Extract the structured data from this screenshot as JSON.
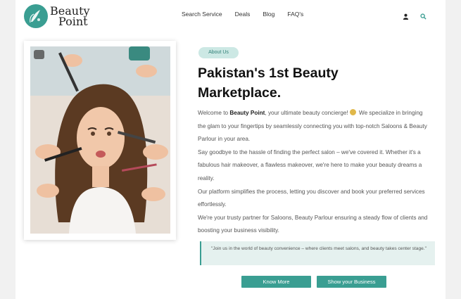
{
  "brand": {
    "line1": "Beauty",
    "line2": "Point"
  },
  "nav": {
    "items": [
      "Search Service",
      "Deals",
      "Blog",
      "FAQ's"
    ]
  },
  "header_icons": [
    "user-icon",
    "search-icon"
  ],
  "about": {
    "badge": "About Us",
    "title": "Pakistan's 1st Beauty Marketplace.",
    "p1_pre": "Welcome to ",
    "p1_brand": "Beauty Point",
    "p1_post": ", your ultimate beauty concierge!",
    "p1_post2": " We specialize in bringing the glam to your fingertips by seamlessly connecting you with top-notch Saloons & Beauty Parlour in your area.",
    "p2": "Say goodbye to the hassle of finding the perfect salon – we've covered it. Whether it's a fabulous hair makeover, a flawless makeover, we're here to make your beauty dreams a reality.",
    "p3": "Our platform simplifies the process, letting you discover and book your preferred services effortlessly.",
    "p4": "We're your trusty partner for Saloons, Beauty Parlour ensuring a steady flow of clients and boosting your business visibility.",
    "quote": "\"Join us in the world of beauty convenience – where clients meet salons, and beauty takes center stage.\""
  },
  "buttons": {
    "know_more": "Know More",
    "show_business": "Show your Business"
  },
  "colors": {
    "accent": "#3a9e92",
    "badge_bg": "#cce8e4",
    "quote_bg": "#e5f1ef"
  }
}
